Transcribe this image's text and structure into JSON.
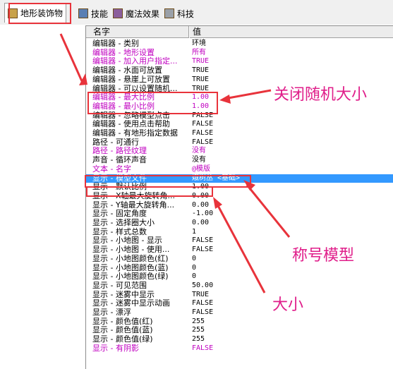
{
  "tabs": [
    {
      "label": "地形装饰物",
      "icon": "doodad-icon"
    },
    {
      "label": "技能",
      "icon": "ability-icon"
    },
    {
      "label": "魔法效果",
      "icon": "buff-icon"
    },
    {
      "label": "科技",
      "icon": "upgrade-icon"
    }
  ],
  "table": {
    "col_name": "名字",
    "col_value": "值",
    "rows": [
      {
        "name": "编辑器 - 类别",
        "value": "环境",
        "color": "#000000"
      },
      {
        "name": "编辑器 - 地形设置",
        "value": "所有",
        "color": "#c000c0"
      },
      {
        "name": "编辑器 - 加入用户指定...",
        "value": "TRUE",
        "color": "#c000c0"
      },
      {
        "name": "编辑器 - 水面可放置",
        "value": "TRUE",
        "color": "#000000"
      },
      {
        "name": "编辑器 - 悬崖上可放置",
        "value": "TRUE",
        "color": "#000000"
      },
      {
        "name": "编辑器 - 可以设置随机...",
        "value": "TRUE",
        "color": "#000000"
      },
      {
        "name": "编辑器 - 最大比例",
        "value": "1.00",
        "color": "#c000c0"
      },
      {
        "name": "编辑器 - 最小比例",
        "value": "1.00",
        "color": "#c000c0"
      },
      {
        "name": "编辑器 - 忽略模型点击",
        "value": "FALSE",
        "color": "#000000"
      },
      {
        "name": "编辑器 - 使用点击帮助",
        "value": "FALSE",
        "color": "#000000"
      },
      {
        "name": "编辑器 - 有地形指定数据",
        "value": "FALSE",
        "color": "#000000"
      },
      {
        "name": "路径 - 可通行",
        "value": "FALSE",
        "color": "#000000"
      },
      {
        "name": "路径 - 路径纹理",
        "value": "没有",
        "color": "#c000c0"
      },
      {
        "name": "声音 - 循环声音",
        "value": "没有",
        "color": "#000000"
      },
      {
        "name": "文本 - 名字",
        "value": "@模版",
        "color": "#c000c0"
      },
      {
        "name": "显示 - 模型文件",
        "value": "娥树丛 <基础>",
        "color": "#000000",
        "selected": true
      },
      {
        "name": "显示 - 默认比例",
        "value": "1.00",
        "color": "#000000"
      },
      {
        "name": "显示 - X轴最大旋转角...",
        "value": "0.00",
        "color": "#000000"
      },
      {
        "name": "显示 - Y轴最大旋转角...",
        "value": "0.00",
        "color": "#000000"
      },
      {
        "name": "显示 - 固定角度",
        "value": "-1.00",
        "color": "#000000"
      },
      {
        "name": "显示 - 选择圈大小",
        "value": "0.00",
        "color": "#000000"
      },
      {
        "name": "显示 - 样式总数",
        "value": "1",
        "color": "#000000"
      },
      {
        "name": "显示 - 小地图 - 显示",
        "value": "FALSE",
        "color": "#000000"
      },
      {
        "name": "显示 - 小地图 - 使用...",
        "value": "FALSE",
        "color": "#000000"
      },
      {
        "name": "显示 - 小地图颜色(红)",
        "value": "0",
        "color": "#000000"
      },
      {
        "name": "显示 - 小地图颜色(蓝)",
        "value": "0",
        "color": "#000000"
      },
      {
        "name": "显示 - 小地图颜色(绿)",
        "value": "0",
        "color": "#000000"
      },
      {
        "name": "显示 - 可见范围",
        "value": "50.00",
        "color": "#000000"
      },
      {
        "name": "显示 - 迷雾中显示",
        "value": "TRUE",
        "color": "#000000"
      },
      {
        "name": "显示 - 迷雾中显示动画",
        "value": "FALSE",
        "color": "#000000"
      },
      {
        "name": "显示 - 漂浮",
        "value": "FALSE",
        "color": "#000000"
      },
      {
        "name": "显示 - 颜色值(红)",
        "value": "255",
        "color": "#000000"
      },
      {
        "name": "显示 - 颜色值(蓝)",
        "value": "255",
        "color": "#000000"
      },
      {
        "name": "显示 - 颜色值(绿)",
        "value": "255",
        "color": "#000000"
      },
      {
        "name": "显示 - 有阴影",
        "value": "FALSE",
        "color": "#c000c0"
      }
    ]
  },
  "annotations": {
    "random_size": "关闭随机大小",
    "model_title": "称号模型",
    "size": "大小"
  },
  "colors": {
    "annotation": "#e01e8a",
    "highlight_box": "#e8333b",
    "selection": "#3399ff",
    "modified_text": "#c000c0"
  }
}
